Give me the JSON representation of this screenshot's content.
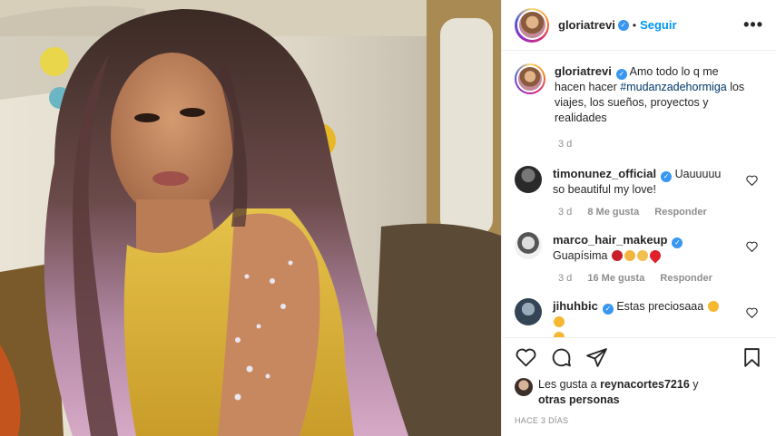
{
  "post": {
    "author": {
      "username": "gloriatrevi",
      "verified": true,
      "follow_label": "Seguir",
      "separator": "•",
      "more_label": "•••"
    },
    "caption": {
      "username": "gloriatrevi",
      "text_before": "Amo todo lo q me hacen hacer ",
      "hashtag": "#mudanzadehormiga",
      "text_after": " los viajes, los sueños, proyectos y realidades",
      "time": "3 d"
    },
    "comments": [
      {
        "username": "timonunez_official",
        "verified": true,
        "text": "Uauuuuu so beautiful my love!",
        "time": "3 d",
        "likes": "8 Me gusta",
        "reply": "Responder"
      },
      {
        "username": "marco_hair_makeup",
        "verified": true,
        "text": "Guapísima",
        "emojis": [
          "rose",
          "clap",
          "pray",
          "red-heart"
        ],
        "time": "3 d",
        "likes": "16 Me gusta",
        "reply": "Responder"
      },
      {
        "username": "jihuhbic",
        "verified": true,
        "text": "Estas preciosaaa",
        "emojis": [
          "heart-eyes",
          "heart-eyes",
          "heart-eyes"
        ]
      }
    ],
    "liked_by": {
      "prefix": "Les gusta a ",
      "user": "reynacortes7216",
      "middle": " y",
      "others": "otras personas"
    },
    "age": "HACE 3 DÍAS"
  },
  "colors": {
    "accent": "#0095f6",
    "verified": "#3897f0",
    "text": "#262626",
    "muted": "#8e8e8e",
    "hashtag": "#00376b"
  }
}
